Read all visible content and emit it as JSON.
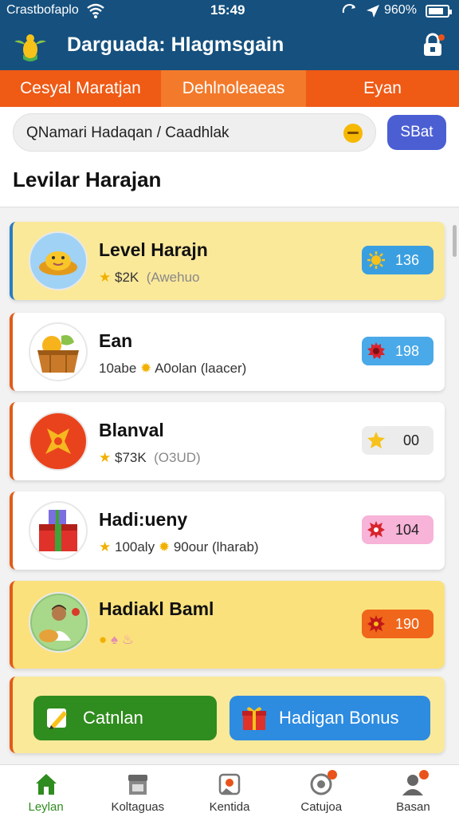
{
  "status": {
    "carrier": "Crastbofaplo",
    "time": "15:49",
    "battery": "960%"
  },
  "app": {
    "title": "Darguada: Hlagmsgain"
  },
  "tabs": [
    {
      "label": "Cesyal Maratjan",
      "active": false
    },
    {
      "label": "Dehlnoleaeas",
      "active": true
    },
    {
      "label": "Eyan",
      "active": false
    }
  ],
  "search": {
    "value": "QNamari Hadaqan / Caadhlak",
    "button": "SBat"
  },
  "section": {
    "title": "Levilar Harajan"
  },
  "items": [
    {
      "name": "Level Harajn",
      "sub_a": "$2K",
      "sub_b": "(Awehuo",
      "badge": "136",
      "badge_color": "#3a9fe0",
      "icon": "sun-icon"
    },
    {
      "name": "Ean",
      "sub_a": "10abe",
      "sub_b": "A0olan (laacer)",
      "badge": "198",
      "badge_color": "#4aa9e8",
      "icon": "gear-icon"
    },
    {
      "name": "Blanval",
      "sub_a": "$73K",
      "sub_b": "(O3UD)",
      "badge": "00",
      "badge_color": "#ececec",
      "icon": "star-icon"
    },
    {
      "name": "Hadi:ueny",
      "sub_a": "100aly",
      "sub_b": "90our (lharab)",
      "badge": "104",
      "badge_color": "#f7b3d8",
      "icon": "burst-icon"
    },
    {
      "name": "Hadiakl Baml",
      "sub_a": "",
      "sub_b": "",
      "badge": "190",
      "badge_color": "#f0661a",
      "icon": "burst-icon"
    }
  ],
  "cta": {
    "primary": "Catnlan",
    "secondary": "Hadigan Bonus"
  },
  "nav": [
    {
      "label": "Leylan",
      "icon": "home-icon",
      "active": true
    },
    {
      "label": "Koltaguas",
      "icon": "store-icon",
      "active": false
    },
    {
      "label": "Kentida",
      "icon": "photo-icon",
      "active": false
    },
    {
      "label": "Catujoa",
      "icon": "chat-icon",
      "active": false
    },
    {
      "label": "Basan",
      "icon": "profile-icon",
      "active": false
    }
  ]
}
